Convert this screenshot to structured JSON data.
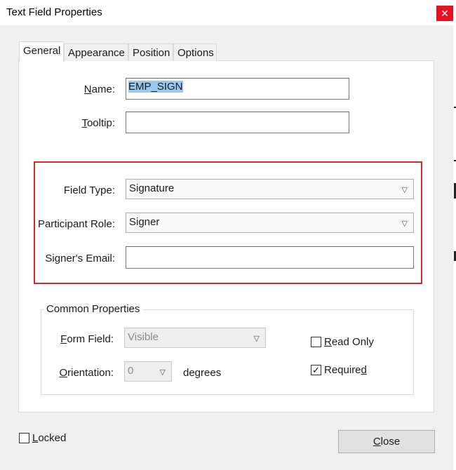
{
  "dialog": {
    "title": "Text Field Properties",
    "close_glyph": "✕"
  },
  "tabs": [
    {
      "label": "General",
      "active": true
    },
    {
      "label": "Appearance",
      "active": false
    },
    {
      "label": "Position",
      "active": false
    },
    {
      "label": "Options",
      "active": false
    }
  ],
  "general": {
    "name": {
      "label_pre": "",
      "label_u": "N",
      "label_post": "ame:",
      "value": "EMP_SIGN"
    },
    "tooltip": {
      "label_pre": "",
      "label_u": "T",
      "label_post": "ooltip:",
      "value": ""
    },
    "field_type": {
      "label": "Field Type:",
      "value": "Signature"
    },
    "participant_role": {
      "label": "Participant Role:",
      "value": "Signer"
    },
    "signer_email": {
      "label": "Signer's Email:",
      "value": ""
    },
    "common": {
      "title": "Common Properties",
      "form_field": {
        "label_pre": "",
        "label_u": "F",
        "label_post": "orm Field:",
        "value": "Visible"
      },
      "orientation": {
        "label_pre": "",
        "label_u": "O",
        "label_post": "rientation:",
        "value": "0",
        "units": "degrees"
      },
      "read_only": {
        "label_pre": "",
        "label_u": "R",
        "label_post": "ead Only",
        "checked": false
      },
      "required": {
        "label_pre": "Require",
        "label_u": "d",
        "label_post": "",
        "checked": true
      }
    }
  },
  "footer": {
    "locked": {
      "label_pre": "",
      "label_u": "L",
      "label_post": "ocked",
      "checked": false
    },
    "close_button": {
      "label_pre": "",
      "label_u": "C",
      "label_post": "lose"
    }
  },
  "check_glyph": "✓",
  "icons": {
    "dropdown": "chevron-down-icon",
    "close": "close-icon",
    "check": "checkmark-icon"
  },
  "colors": {
    "highlight": "#d12a2a",
    "selection": "#99c9ef",
    "close_bg": "#e81123"
  }
}
